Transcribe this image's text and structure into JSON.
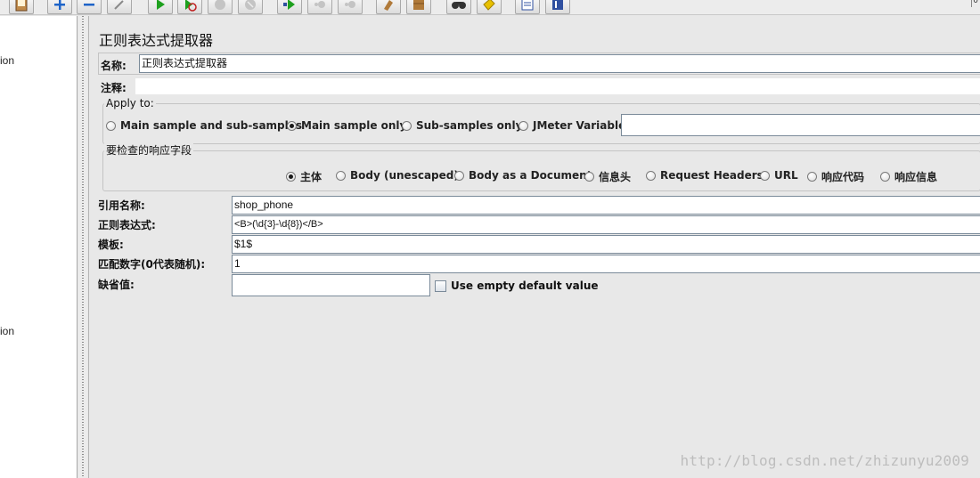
{
  "toolbar": {
    "buttons": [
      {
        "icon": "template-icon",
        "color": "#8b5a2b"
      },
      {
        "icon": "add-icon",
        "color": "#1e64c8"
      },
      {
        "icon": "remove-icon",
        "color": "#1e64c8"
      },
      {
        "icon": "wand-icon",
        "color": "#999999"
      },
      {
        "icon": "start-icon",
        "color": "#1ea01e"
      },
      {
        "icon": "start-no-pauses-icon",
        "color": "#1ea01e"
      },
      {
        "icon": "stop-icon",
        "color": "#aaaaaa"
      },
      {
        "icon": "shutdown-icon",
        "color": "#aaaaaa"
      },
      {
        "icon": "remote-start-icon",
        "color": "#1ea01e"
      },
      {
        "icon": "remote-stop-icon",
        "color": "#aaaaaa"
      },
      {
        "icon": "remote-shutdown-icon",
        "color": "#aaaaaa"
      },
      {
        "icon": "clear-icon",
        "color": "#b07a3a"
      },
      {
        "icon": "clear-all-icon",
        "color": "#b07a3a"
      },
      {
        "icon": "search-icon",
        "color": "#333333"
      },
      {
        "icon": "reset-search-icon",
        "color": "#e0b000"
      },
      {
        "icon": "function-helper-icon",
        "color": "#3050a0"
      },
      {
        "icon": "help-icon",
        "color": "#3050a0"
      }
    ],
    "right_text": "0"
  },
  "tree": {
    "items": [
      "ion",
      "ion"
    ]
  },
  "panel": {
    "title": "正则表达式提取器",
    "name_label": "名称:",
    "name_value": "正则表达式提取器",
    "comment_label": "注释:",
    "comment_value": "",
    "apply_to": {
      "title": "Apply to:",
      "options": [
        {
          "label": "Main sample and sub-samples",
          "checked": false
        },
        {
          "label": "Main sample only",
          "checked": true
        },
        {
          "label": "Sub-samples only",
          "checked": false
        },
        {
          "label": "JMeter Variable",
          "checked": false
        }
      ],
      "variable_value": ""
    },
    "field_to_check": {
      "title": "要检查的响应字段",
      "options": [
        {
          "label": "主体",
          "checked": true
        },
        {
          "label": "Body (unescaped)",
          "checked": false
        },
        {
          "label": "Body as a Document",
          "checked": false
        },
        {
          "label": "信息头",
          "checked": false
        },
        {
          "label": "Request Headers",
          "checked": false
        },
        {
          "label": "URL",
          "checked": false
        },
        {
          "label": "响应代码",
          "checked": false
        },
        {
          "label": "响应信息",
          "checked": false
        }
      ]
    },
    "fields": {
      "ref_name_label": "引用名称:",
      "ref_name_value": "shop_phone",
      "regex_label": "正则表达式:",
      "regex_value": "<B>(\\d{3}-\\d{8})</B>",
      "template_label": "模板:",
      "template_value": "$1$",
      "match_no_label": "匹配数字(0代表随机):",
      "match_no_value": "1",
      "default_label": "缺省值:",
      "default_value": "",
      "use_empty_label": "Use empty default value",
      "use_empty_checked": false
    }
  },
  "watermark": "http://blog.csdn.net/zhizunyu2009"
}
